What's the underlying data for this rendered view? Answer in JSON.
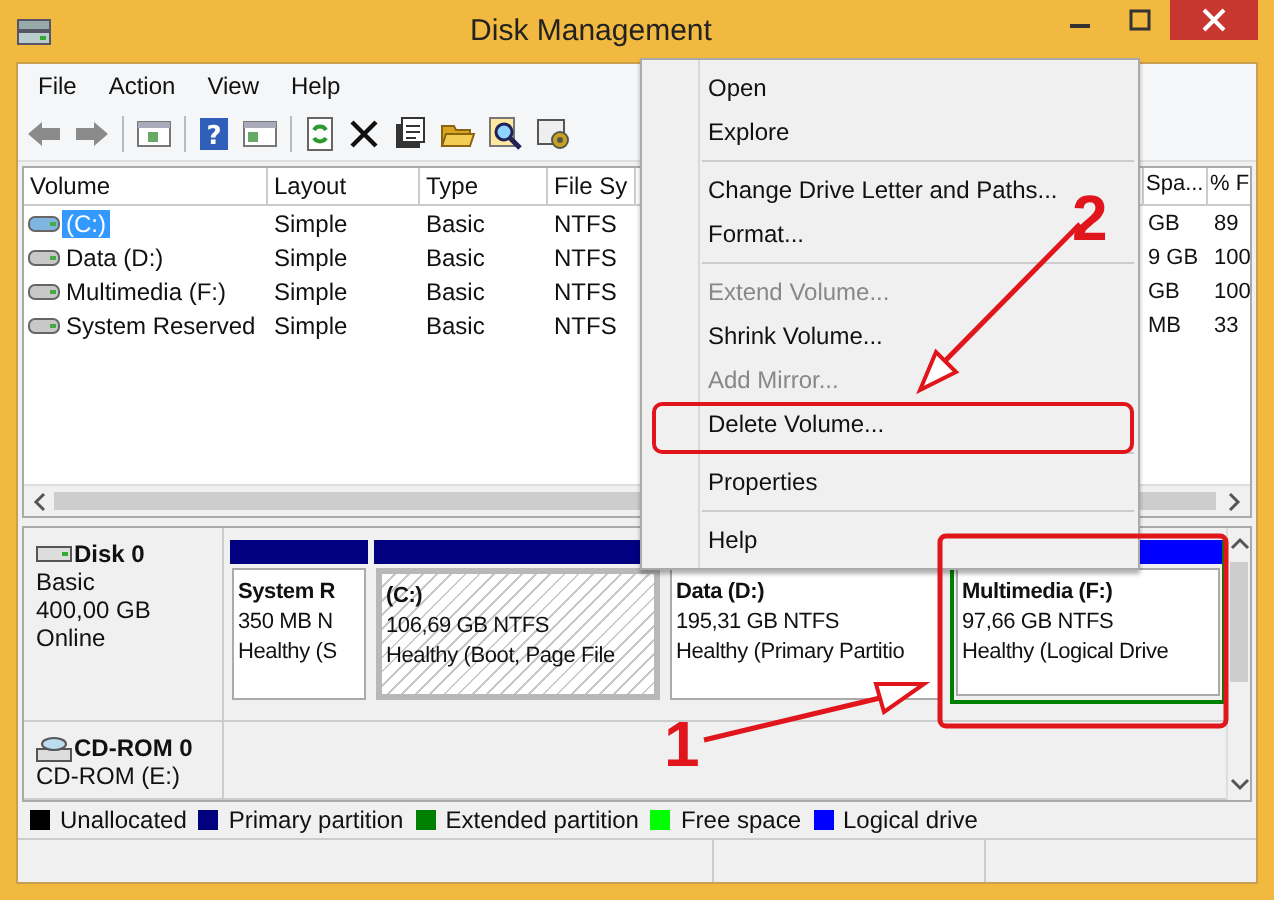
{
  "window": {
    "title": "Disk Management"
  },
  "menu": [
    "File",
    "Action",
    "View",
    "Help"
  ],
  "toolbar": {
    "help_glyph": "?"
  },
  "volumes": {
    "columns": [
      "Volume",
      "Layout",
      "Type",
      "File Sy",
      "Spa...",
      "% F"
    ],
    "rows": [
      {
        "cells": [
          "(C:)",
          "Simple",
          "Basic",
          "NTFS",
          "GB",
          "89"
        ],
        "selected": true
      },
      {
        "cells": [
          "Data (D:)",
          "Simple",
          "Basic",
          "NTFS",
          "9 GB",
          "100"
        ],
        "selected": false
      },
      {
        "cells": [
          "Multimedia (F:)",
          "Simple",
          "Basic",
          "NTFS",
          "GB",
          "100"
        ],
        "selected": false
      },
      {
        "cells": [
          "System Reserved",
          "Simple",
          "Basic",
          "NTFS",
          "MB",
          "33"
        ],
        "selected": false
      }
    ]
  },
  "disks": [
    {
      "kind": "disk",
      "name": "Disk 0",
      "lines": [
        "Basic",
        "400,00 GB",
        "Online"
      ],
      "partitions": [
        {
          "name": "System R",
          "size": "350 MB N",
          "status": "Healthy (S",
          "color": "#000080",
          "selected": false,
          "extended": false
        },
        {
          "name": "(C:)",
          "size": "106,69 GB NTFS",
          "status": "Healthy (Boot, Page File",
          "color": "#000080",
          "selected": true,
          "extended": false
        },
        {
          "name": "Data  (D:)",
          "size": "195,31 GB NTFS",
          "status": "Healthy (Primary Partitio",
          "selected": false,
          "extended": false
        },
        {
          "name": "Multimedia  (F:)",
          "size": "97,66 GB NTFS",
          "status": "Healthy (Logical Drive",
          "color": "#0000ff",
          "selected": false,
          "extended": true
        }
      ]
    },
    {
      "kind": "cdrom",
      "name": "CD-ROM 0",
      "lines": [
        "CD-ROM (E:)"
      ]
    }
  ],
  "legend": [
    {
      "label": "Unallocated",
      "color": "#000000"
    },
    {
      "label": "Primary partition",
      "color": "#000080"
    },
    {
      "label": "Extended partition",
      "color": "#008000"
    },
    {
      "label": "Free space",
      "color": "#00ff00"
    },
    {
      "label": "Logical drive",
      "color": "#0000ff"
    }
  ],
  "context_menu": {
    "items": [
      {
        "kind": "item",
        "label": "Open",
        "disabled": false
      },
      {
        "kind": "item",
        "label": "Explore",
        "disabled": false
      },
      {
        "kind": "separator"
      },
      {
        "kind": "item",
        "label": "Change Drive Letter and Paths...",
        "disabled": false
      },
      {
        "kind": "item",
        "label": "Format...",
        "disabled": false
      },
      {
        "kind": "separator"
      },
      {
        "kind": "item",
        "label": "Extend Volume...",
        "disabled": true
      },
      {
        "kind": "item",
        "label": "Shrink Volume...",
        "disabled": false
      },
      {
        "kind": "item",
        "label": "Add Mirror...",
        "disabled": true
      },
      {
        "kind": "item",
        "label": "Delete Volume...",
        "disabled": false
      },
      {
        "kind": "separator"
      },
      {
        "kind": "item",
        "label": "Properties",
        "disabled": false
      },
      {
        "kind": "separator"
      },
      {
        "kind": "item",
        "label": "Help",
        "disabled": false
      }
    ]
  },
  "annotations": [
    {
      "label": "1"
    },
    {
      "label": "2"
    }
  ]
}
